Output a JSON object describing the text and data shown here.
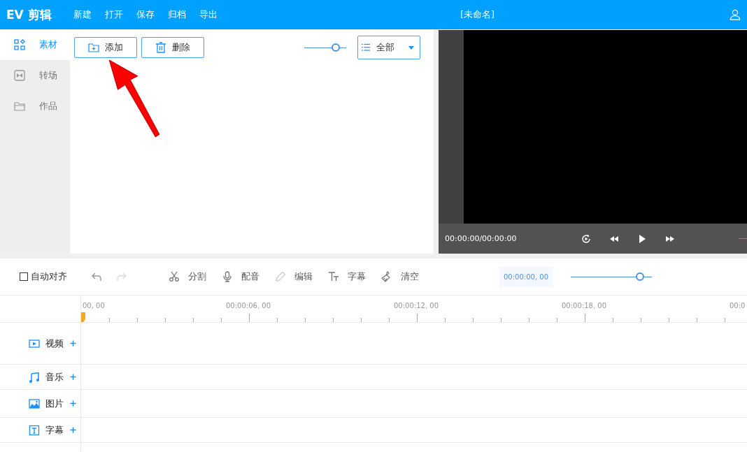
{
  "header": {
    "logo": "EV 剪辑",
    "menu": [
      "新建",
      "打开",
      "保存",
      "归档",
      "导出"
    ],
    "title": "[未命名]"
  },
  "sidebar": {
    "items": [
      {
        "label": "素材",
        "kind": "grid",
        "selected": true
      },
      {
        "label": "转场",
        "kind": "transition",
        "selected": false
      },
      {
        "label": "作品",
        "kind": "folder",
        "selected": false
      }
    ]
  },
  "library": {
    "buttons": [
      {
        "label": "添加",
        "kind": "add"
      },
      {
        "label": "删除",
        "kind": "delete"
      }
    ],
    "zoom_slider": {
      "level": 0.75
    },
    "filter": {
      "value": "全部"
    }
  },
  "player": {
    "time": "00:00:00/00:00:00"
  },
  "timeline_toolbar": {
    "auto_align": {
      "label": "自动对齐",
      "checked": false
    },
    "history": [
      {
        "kind": "undo",
        "disabled": false
      },
      {
        "kind": "redo",
        "disabled": true
      }
    ],
    "tools": [
      {
        "label": "分割",
        "kind": "split",
        "disabled": false
      },
      {
        "label": "配音",
        "kind": "voice",
        "disabled": false
      },
      {
        "label": "编辑",
        "kind": "edit",
        "disabled": true
      },
      {
        "label": "字幕",
        "kind": "subtitle",
        "disabled": false
      },
      {
        "label": "清空",
        "kind": "clear",
        "disabled": false
      }
    ],
    "current_time": "00:00:00, 00",
    "zoom_slider": {
      "level": 0.85
    }
  },
  "ruler": {
    "labels": [
      "00, 00",
      "00:00:06, 00",
      "00:00:12, 00",
      "00:00:18, 00",
      "00:0"
    ]
  },
  "tracks": [
    {
      "label": "视频",
      "kind": "video"
    },
    {
      "label": "音乐",
      "kind": "music"
    },
    {
      "label": "图片",
      "kind": "image"
    },
    {
      "label": "字幕",
      "kind": "text"
    }
  ]
}
